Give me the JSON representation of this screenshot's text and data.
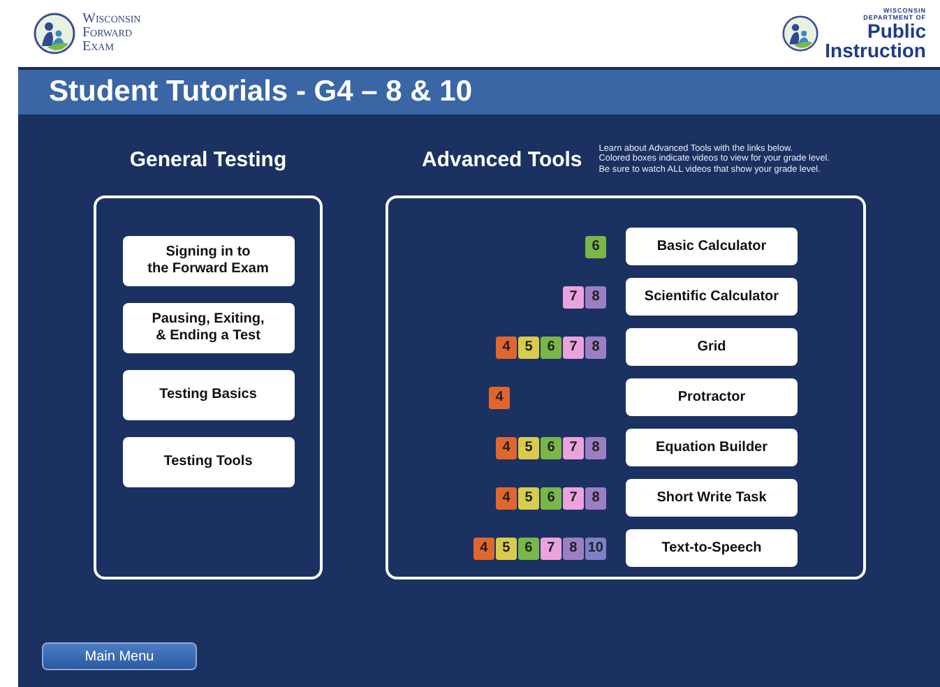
{
  "header": {
    "left_logo": [
      "Wisconsin",
      "Forward",
      "Exam"
    ],
    "right_logo": {
      "small_lines": [
        "WISCONSIN",
        "DEPARTMENT OF"
      ],
      "big_lines": [
        "Public",
        "Instruction"
      ]
    }
  },
  "title": "Student Tutorials - G4 – 8 & 10",
  "general_testing": {
    "heading": "General Testing",
    "buttons": [
      [
        "Signing in to",
        "the Forward Exam"
      ],
      [
        "Pausing, Exiting,",
        "& Ending a Test"
      ],
      [
        "Testing Basics"
      ],
      [
        "Testing Tools"
      ]
    ]
  },
  "advanced_tools": {
    "heading": "Advanced Tools",
    "note": [
      "Learn about Advanced Tools with the links below.",
      "Colored boxes indicate videos to view for your grade level.",
      "Be sure to watch ALL videos that show your grade level."
    ],
    "tools": [
      {
        "label": "Basic Calculator",
        "grades": [
          {
            "grade": "6",
            "color": "#7ab648"
          }
        ]
      },
      {
        "label": "Scientific Calculator",
        "grades": [
          {
            "grade": "7",
            "color": "#eaa3dc"
          },
          {
            "grade": "8",
            "color": "#9b7fc2"
          }
        ]
      },
      {
        "label": "Grid",
        "grades": [
          {
            "grade": "4",
            "color": "#e0662f"
          },
          {
            "grade": "5",
            "color": "#d9cb4c"
          },
          {
            "grade": "6",
            "color": "#7ab648"
          },
          {
            "grade": "7",
            "color": "#eaa3dc"
          },
          {
            "grade": "8",
            "color": "#9b7fc2"
          }
        ]
      },
      {
        "label": "Protractor",
        "grades": [
          {
            "grade": "4",
            "color": "#e0662f"
          }
        ],
        "kind": "left"
      },
      {
        "label": "Equation Builder",
        "grades": [
          {
            "grade": "4",
            "color": "#e0662f"
          },
          {
            "grade": "5",
            "color": "#d9cb4c"
          },
          {
            "grade": "6",
            "color": "#7ab648"
          },
          {
            "grade": "7",
            "color": "#eaa3dc"
          },
          {
            "grade": "8",
            "color": "#9b7fc2"
          }
        ]
      },
      {
        "label": "Short Write Task",
        "grades": [
          {
            "grade": "4",
            "color": "#e0662f"
          },
          {
            "grade": "5",
            "color": "#d9cb4c"
          },
          {
            "grade": "6",
            "color": "#7ab648"
          },
          {
            "grade": "7",
            "color": "#eaa3dc"
          },
          {
            "grade": "8",
            "color": "#9b7fc2"
          }
        ]
      },
      {
        "label": "Text-to-Speech",
        "grades": [
          {
            "grade": "4",
            "color": "#e0662f"
          },
          {
            "grade": "5",
            "color": "#d9cb4c"
          },
          {
            "grade": "6",
            "color": "#7ab648"
          },
          {
            "grade": "7",
            "color": "#eaa3dc"
          },
          {
            "grade": "8",
            "color": "#9b7fc2"
          },
          {
            "grade": "10",
            "color": "#7c80c6"
          }
        ]
      }
    ]
  },
  "footer": {
    "button": "Main Menu"
  }
}
